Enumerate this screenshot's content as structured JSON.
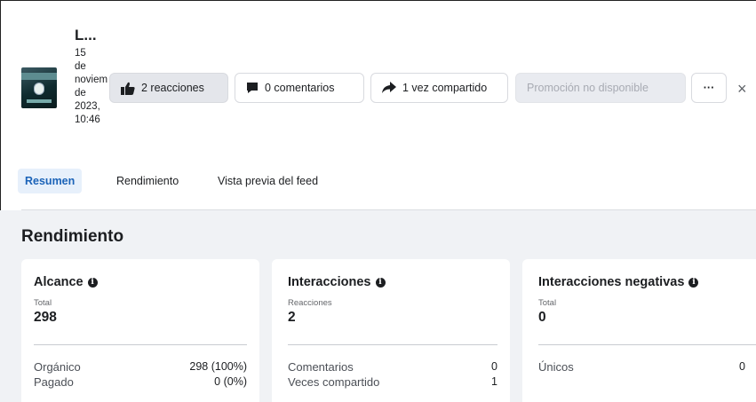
{
  "post": {
    "title": "L...",
    "date": "15\nde\nnoviem\nde\n2023,\n10:46"
  },
  "actions": {
    "reactions": "2 reacciones",
    "comments": "0 comentarios",
    "shares": "1 vez compartido",
    "promotion": "Promoción no disponible",
    "more": "···",
    "close": "×"
  },
  "tabs": [
    {
      "label": "Resumen",
      "active": true
    },
    {
      "label": "Rendimiento",
      "active": false
    },
    {
      "label": "Vista previa del feed",
      "active": false
    }
  ],
  "section": {
    "title": "Rendimiento"
  },
  "cards": [
    {
      "title": "Alcance",
      "sub": "Total",
      "value": "298",
      "rows": [
        {
          "label": "Orgánico",
          "value": "298 (100%)"
        },
        {
          "label": "Pagado",
          "value": "0 (0%)"
        }
      ]
    },
    {
      "title": "Interacciones",
      "sub": "Reacciones",
      "value": "2",
      "rows": [
        {
          "label": "Comentarios",
          "value": "0"
        },
        {
          "label": "Veces compartido",
          "value": "1"
        }
      ]
    },
    {
      "title": "Interacciones negativas",
      "sub": "Total",
      "value": "0",
      "rows": [
        {
          "label": "Únicos",
          "value": "0"
        }
      ]
    }
  ],
  "colors": {
    "accent": "#1b63b8",
    "tab_active_bg": "#e7f0fb",
    "section_bg": "#f0f2f5",
    "button_bg": "#e4e6eb"
  }
}
